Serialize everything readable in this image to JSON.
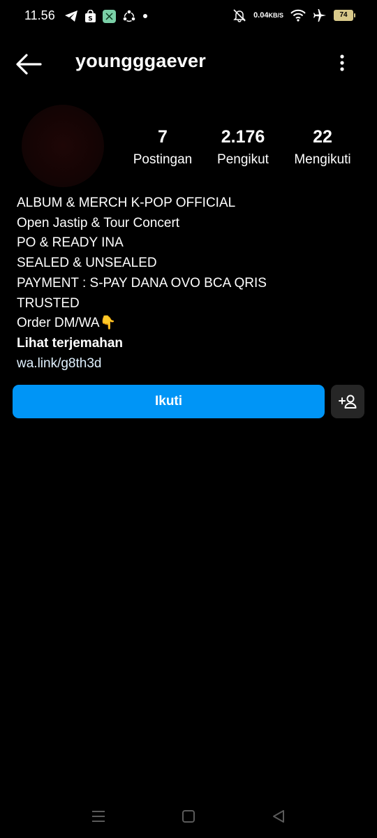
{
  "status_bar": {
    "time": "11.56",
    "net_speed_value": "0.04",
    "net_speed_unit": "KB/S",
    "battery": "74",
    "left_icons": [
      "telegram-icon",
      "shopee-icon",
      "grab-icon",
      "sync-icon",
      "dot-icon"
    ],
    "right_icons": [
      "mute-icon",
      "wifi-icon",
      "airplane-icon"
    ]
  },
  "header": {
    "username": "youngggaever"
  },
  "profile": {
    "stats": [
      {
        "value": "7",
        "label": "Postingan"
      },
      {
        "value": "2.176",
        "label": "Pengikut"
      },
      {
        "value": "22",
        "label": "Mengikuti"
      }
    ]
  },
  "bio": {
    "lines": [
      "ALBUM & MERCH K-POP OFFICIAL",
      "Open Jastip & Tour Concert",
      "PO & READY INA",
      "SEALED & UNSEALED",
      "PAYMENT : S-PAY DANA OVO BCA QRIS",
      "TRUSTED",
      "Order DM/WA👇"
    ],
    "translate_label": "Lihat terjemahan",
    "link": "wa.link/g8th3d"
  },
  "actions": {
    "follow_label": "Ikuti",
    "suggest_icon": "add-person-icon"
  },
  "colors": {
    "background": "#000000",
    "primary_button": "#0095f6",
    "secondary_button": "#262626",
    "text": "#ffffff"
  }
}
